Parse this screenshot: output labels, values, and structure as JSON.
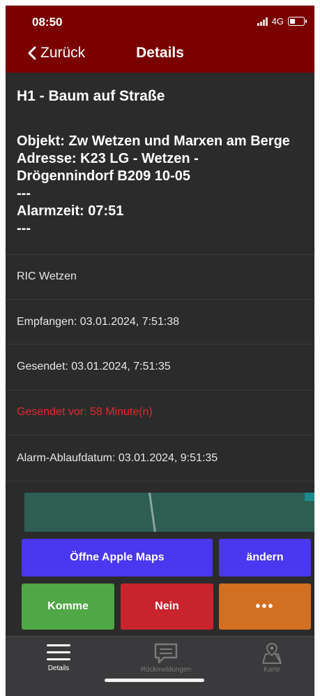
{
  "status_bar": {
    "time": "08:50",
    "network": "4G"
  },
  "nav": {
    "back_label": "Zurück",
    "title": "Details"
  },
  "alarm": {
    "title": "H1 - Baum auf Straße",
    "object_line": "Objekt: Zw Wetzen und Marxen am Berge",
    "address_line1": "Adresse: K23 LG - Wetzen -",
    "address_line2": "Drögennindorf B209 10-05",
    "separator": "---",
    "alarm_time": "Alarmzeit: 07:51"
  },
  "rows": {
    "ric": "RIC Wetzen",
    "received": "Empfangen: 03.01.2024, 7:51:38",
    "sent": "Gesendet: 03.01.2024, 7:51:35",
    "sent_ago": "Gesendet vor: 58 Minute(n)",
    "expiry": "Alarm-Ablaufdatum: 03.01.2024, 9:51:35"
  },
  "actions": {
    "open_maps": "Öffne Apple Maps",
    "change": "ändern",
    "come": "Komme",
    "no": "Nein",
    "more": "•••"
  },
  "tabs": {
    "details": "Details",
    "feedback": "Rückmeldungen",
    "map": "Karte"
  },
  "colors": {
    "header": "#7a0000",
    "background": "#2b2b2b",
    "primary_button": "#4a37f0",
    "yes_button": "#4fa745",
    "no_button": "#c9242e",
    "more_button": "#d26f21",
    "warning_text": "#e2272d"
  }
}
